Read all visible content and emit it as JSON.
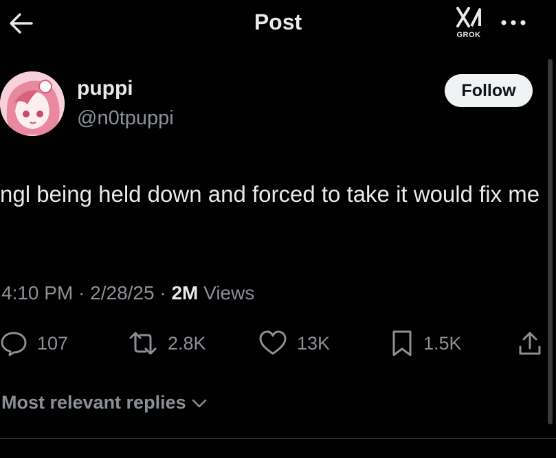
{
  "header": {
    "title": "Post",
    "grok_label": "GROK",
    "back_icon": "back-arrow-icon",
    "more_icon": "more-horizontal-icon"
  },
  "author": {
    "display_name": "puppi",
    "handle": "@n0tpuppi",
    "follow_label": "Follow"
  },
  "post": {
    "text": "ngl being held down and forced to take it would fix me",
    "timestamp": "4:10 PM · 2/28/25 · ",
    "views_count": "2M",
    "views_label": " Views"
  },
  "actions": {
    "replies": "107",
    "reposts": "2.8K",
    "likes": "13K",
    "bookmarks": "1.5K"
  },
  "replies_sort": {
    "label": "Most relevant replies"
  },
  "colors": {
    "background": "#000000",
    "text": "#e7e9ea",
    "secondary_text": "#8b9096",
    "follow_bg": "#eff3f4"
  }
}
